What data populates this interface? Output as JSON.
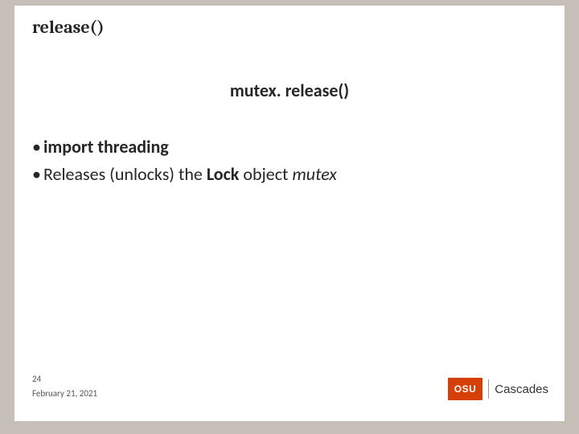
{
  "title": "release()",
  "subtitle": "mutex. release()",
  "bullets": {
    "b1": "import threading",
    "b2_pre": "Releases (unlocks) the ",
    "b2_lock": "Lock",
    "b2_mid": " object ",
    "b2_mutex": "mutex"
  },
  "footer": {
    "page": "24",
    "date": "February 21, 2021"
  },
  "logo": {
    "osu": "OSU",
    "cascades": "Cascades"
  }
}
